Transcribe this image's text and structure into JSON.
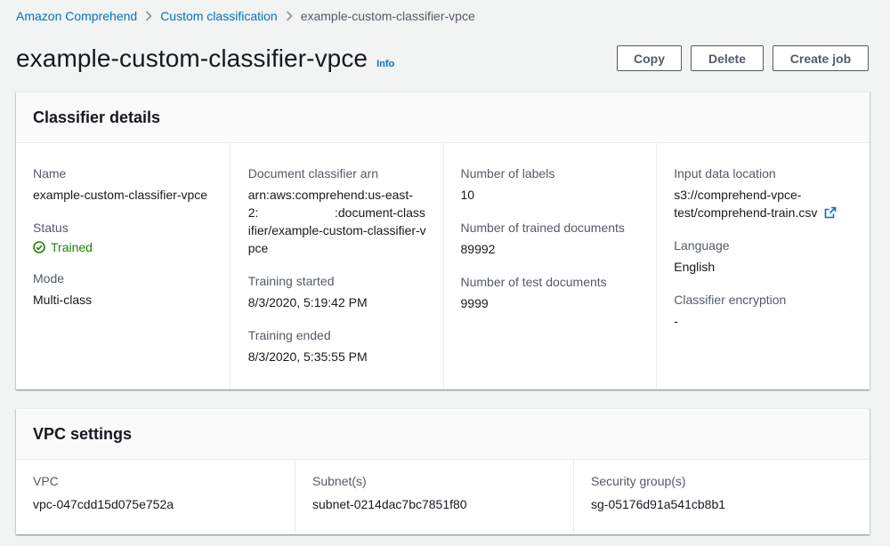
{
  "breadcrumb": {
    "items": [
      "Amazon Comprehend",
      "Custom classification",
      "example-custom-classifier-vpce"
    ]
  },
  "header": {
    "title": "example-custom-classifier-vpce",
    "info_label": "Info",
    "buttons": {
      "copy": "Copy",
      "delete": "Delete",
      "create_job": "Create job"
    }
  },
  "classifier_details": {
    "heading": "Classifier details",
    "name_label": "Name",
    "name_value": "example-custom-classifier-vpce",
    "status_label": "Status",
    "status_value": "Trained",
    "mode_label": "Mode",
    "mode_value": "Multi-class",
    "arn_label": "Document classifier arn",
    "arn_value": "arn:aws:comprehend:us-east-2:                      :document-classifier/example-custom-classifier-vpce",
    "training_started_label": "Training started",
    "training_started_value": "8/3/2020, 5:19:42 PM",
    "training_ended_label": "Training ended",
    "training_ended_value": "8/3/2020, 5:35:55 PM",
    "labels_label": "Number of labels",
    "labels_value": "10",
    "trained_docs_label": "Number of trained documents",
    "trained_docs_value": "89992",
    "test_docs_label": "Number of test documents",
    "test_docs_value": "9999",
    "input_location_label": "Input data location",
    "input_location_line1": "s3://comprehend-vpce-",
    "input_location_line2": "test/comprehend-train.csv",
    "language_label": "Language",
    "language_value": "English",
    "encryption_label": "Classifier encryption",
    "encryption_value": "-"
  },
  "vpc_settings": {
    "heading": "VPC settings",
    "vpc_label": "VPC",
    "vpc_value": "vpc-047cdd15d075e752a",
    "subnet_label": "Subnet(s)",
    "subnet_value": "subnet-0214dac7bc7851f80",
    "sg_label": "Security group(s)",
    "sg_value": "sg-05176d91a541cb8b1"
  },
  "colors": {
    "link": "#0073bb",
    "success": "#1d8102",
    "label": "#545b64",
    "text": "#16191f",
    "background": "#f2f3f3"
  },
  "icons": [
    "chevron-right-icon",
    "check-circle-icon",
    "external-link-icon"
  ]
}
